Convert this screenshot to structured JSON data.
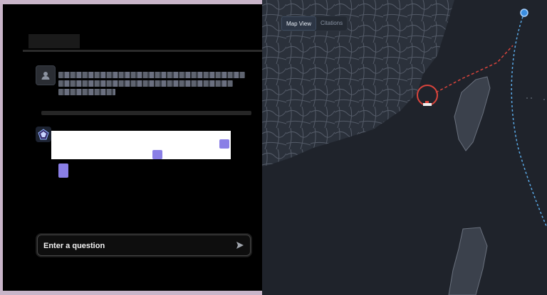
{
  "chat": {
    "heading": "",
    "user_message": "",
    "bot_message": "",
    "input_placeholder": "Enter a question",
    "send_icon": "send-arrow-icon"
  },
  "map": {
    "tabs": [
      {
        "label": "Map View",
        "active": true
      },
      {
        "label": "Citations",
        "active": false
      }
    ],
    "colors": {
      "land": "#2b313b",
      "sea": "#1f232b",
      "roads": "#59606d",
      "route_red": "#d9443c",
      "route_blue": "#5aa9e6"
    }
  }
}
